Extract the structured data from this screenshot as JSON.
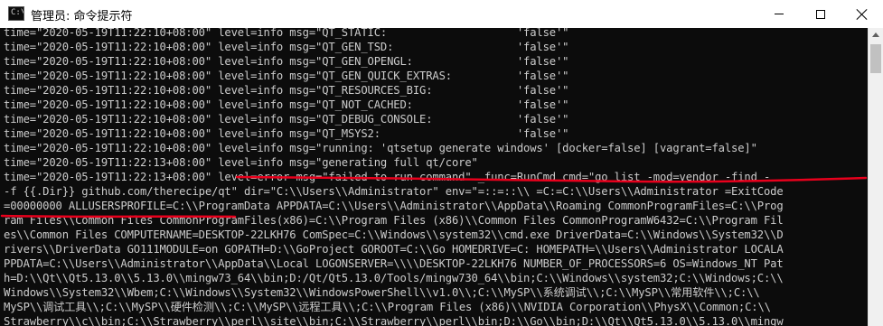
{
  "window": {
    "title": "管理员: 命令提示符",
    "icon": "cmd-icon",
    "icon_glyph": "C:\\"
  },
  "console": {
    "background": "#0c0c0c",
    "text_color": "#cccccc",
    "annotation_color": "#e8001c",
    "lines": [
      "time=\"2020-05-19T11:22:10+08:00\" level=info msg=\"QT_STATIC:                    'false'\"",
      "time=\"2020-05-19T11:22:10+08:00\" level=info msg=\"QT_GEN_TSD:                   'false'\"",
      "time=\"2020-05-19T11:22:10+08:00\" level=info msg=\"QT_GEN_OPENGL:                'false'\"",
      "time=\"2020-05-19T11:22:10+08:00\" level=info msg=\"QT_GEN_QUICK_EXTRAS:          'false'\"",
      "time=\"2020-05-19T11:22:10+08:00\" level=info msg=\"QT_RESOURCES_BIG:             'false'\"",
      "time=\"2020-05-19T11:22:10+08:00\" level=info msg=\"QT_NOT_CACHED:                'false'\"",
      "time=\"2020-05-19T11:22:10+08:00\" level=info msg=\"QT_DEBUG_CONSOLE:             'false'\"",
      "time=\"2020-05-19T11:22:10+08:00\" level=info msg=\"QT_MSYS2:                     'false'\"",
      "time=\"2020-05-19T11:22:10+08:00\" level=info msg=\"running: 'qtsetup generate windows' [docker=false] [vagrant=false]\"",
      "time=\"2020-05-19T11:22:13+08:00\" level=info msg=\"generating full qt/core\"",
      "time=\"2020-05-19T11:22:13+08:00\" level=error msg=\"failed to run command\" _func=RunCmd cmd=\"go list -mod=vendor -find -",
      "-f {{.Dir}} github.com/therecipe/qt\" dir=\"C:\\\\Users\\\\Administrator\" env=\"=::=::\\\\ =C:=C:\\\\Users\\\\Administrator =ExitCode",
      "=00000000 ALLUSERSPROFILE=C:\\\\ProgramData APPDATA=C:\\\\Users\\\\Administrator\\\\AppData\\\\Roaming CommonProgramFiles=C:\\\\Prog",
      "ram Files\\\\Common Files CommonProgramFiles(x86)=C:\\\\Program Files (x86)\\\\Common Files CommonProgramW6432=C:\\\\Program Fil",
      "es\\\\Common Files COMPUTERNAME=DESKTOP-22LKH76 ComSpec=C:\\\\Windows\\\\system32\\\\cmd.exe DriverData=C:\\\\Windows\\\\System32\\\\D",
      "rivers\\\\DriverData GO111MODULE=on GOPATH=D:\\\\GoProject GOROOT=C:\\\\Go HOMEDRIVE=C: HOMEPATH=\\\\Users\\\\Administrator LOCALA",
      "PPDATA=C:\\\\Users\\\\Administrator\\\\AppData\\\\Local LOGONSERVER=\\\\\\\\DESKTOP-22LKH76 NUMBER_OF_PROCESSORS=6 OS=Windows_NT Pat",
      "h=D:\\\\Qt\\\\Qt5.13.0\\\\5.13.0\\\\mingw73_64\\\\bin;D:/Qt/Qt5.13.0/Tools/mingw730_64\\\\bin;C:\\\\Windows\\\\system32;C:\\\\Windows;C:\\\\",
      "Windows\\\\System32\\\\Wbem;C:\\\\Windows\\\\System32\\\\WindowsPowerShell\\\\v1.0\\\\;C:\\\\MySP\\\\系统调试\\\\;C:\\\\MySP\\\\常用软件\\\\;C:\\\\",
      "MySP\\\\调试工具\\\\;C:\\\\MySP\\\\硬件检测\\\\;C:\\\\MySP\\\\远程工具\\\\;C:\\\\Program Files (x86)\\\\NVIDIA Corporation\\\\PhysX\\\\Common;C:\\\\",
      "Strawberry\\\\c\\\\bin;C:\\\\Strawberry\\\\perl\\\\site\\\\bin;C:\\\\Strawberry\\\\perl\\\\bin;D:\\\\Go\\\\bin;D:\\\\Qt\\\\Qt5.13.0\\\\5.13.0\\\\mingw"
    ]
  }
}
